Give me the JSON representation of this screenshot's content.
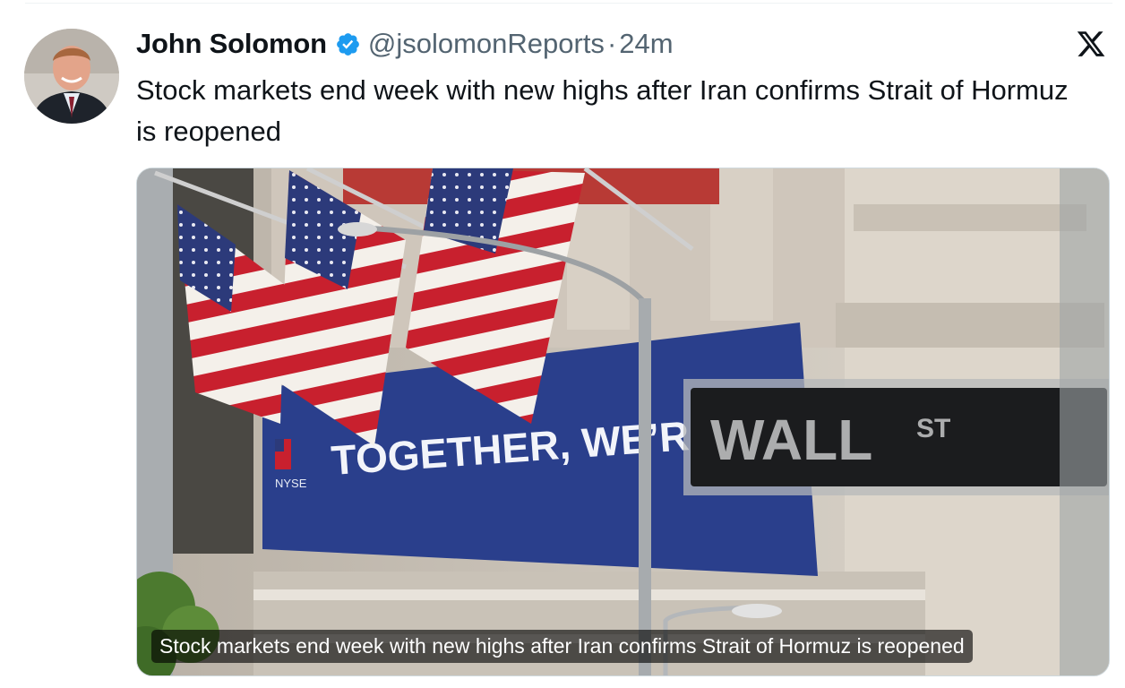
{
  "post": {
    "author_name": "John Solomon",
    "handle": "@jsolomonReports",
    "separator": "·",
    "time_ago": "24m",
    "text": "Stock markets end week with new highs after Iran confirms Strait of Hormuz is reopened"
  },
  "media": {
    "caption": "Stock markets end week with new highs after Iran confirms Strait of Hormuz is reopened",
    "banner_text": "TOGETHER, WE’RE STRONG",
    "banner_logo_text": "NYSE",
    "sign_text": "WALL",
    "sign_suffix": "ST"
  },
  "icons": {
    "verified": "verified-badge-icon",
    "platform": "x-logo-icon"
  },
  "colors": {
    "verified_blue": "#1d9bf0",
    "banner_blue": "#2a3f8c",
    "secondary_text": "#536471"
  }
}
